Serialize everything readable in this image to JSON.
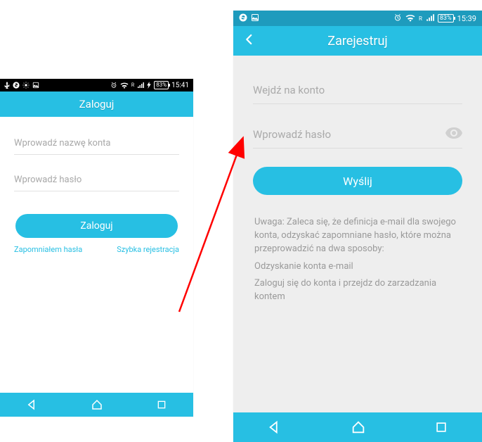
{
  "left": {
    "statusbar": {
      "battery": "83%",
      "time": "15:41"
    },
    "header": {
      "title": "Zaloguj"
    },
    "fields": {
      "account_placeholder": "Wprowadź nazwę konta",
      "password_placeholder": "Wprowadź hasło"
    },
    "submit_label": "Zaloguj",
    "links": {
      "forgot": "Zapomniałem hasła",
      "register": "Szybka rejestracja"
    }
  },
  "right": {
    "statusbar": {
      "battery": "83%",
      "time": "15:39"
    },
    "header": {
      "title": "Zarejestruj"
    },
    "fields": {
      "account_placeholder": "Wejdź na konto",
      "password_placeholder": "Wprowadź hasło"
    },
    "submit_label": "Wyślij",
    "note": {
      "p1": "Uwaga: Zaleca się, że definicja e-mail dla swojego konta, odzyskać zapomniane hasło, które można przeprowadzić na dwa sposoby:",
      "p2": "Odzyskanie konta e-mail",
      "p3": "Zaloguj się do konta i przejdz do zarzadzania kontem"
    }
  },
  "colors": {
    "accent": "#27BFE3",
    "arrow": "#ff0000"
  }
}
